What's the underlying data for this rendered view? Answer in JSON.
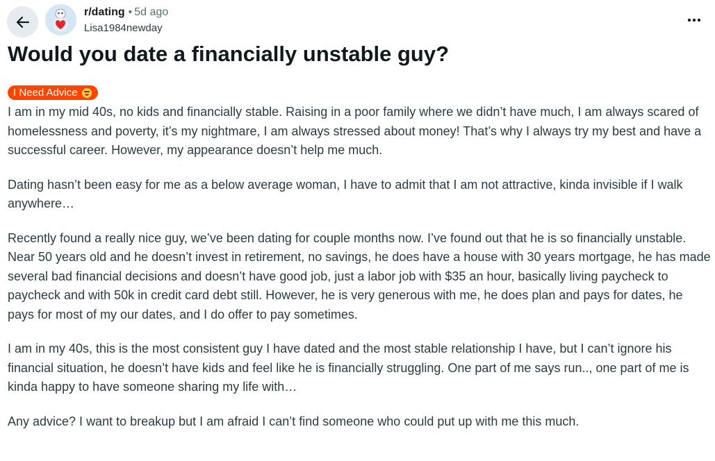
{
  "header": {
    "subreddit": "r/dating",
    "separator": "•",
    "time": "5d ago",
    "author": "Lisa1984newday",
    "back_icon": "arrow-left-icon",
    "more_icon": "more-horizontal-icon"
  },
  "post": {
    "title": "Would you date a financially unstable guy?",
    "flair": {
      "label": "I Need Advice",
      "emoji": "tired-face-emoji",
      "color": "#ff4500"
    },
    "paragraphs": [
      "I am in my mid 40s, no kids and financially stable. Raising in a poor family where we didn’t have much, I am always scared of homelessness and poverty, it’s my nightmare, I am always stressed about money! That’s why I always try my best and have a successful career. However, my appearance doesn’t help me much.",
      "Dating hasn’t been easy for me as a below average woman, I have to admit that I am not attractive, kinda invisible if I walk anywhere…",
      "Recently found a really nice guy, we’ve been dating for couple months now. I’ve found out that he is so financially unstable. Near 50 years old and he doesn’t invest in retirement, no savings, he does have a house with 30 years mortgage, he has made several bad financial decisions and doesn’t have good job, just a labor job with $35 an hour, basically living paycheck to paycheck and with 50k in credit card debt still. However, he is very generous with me, he does plan and pays for dates, he pays for most of my our dates, and I do offer to pay sometimes.",
      "I am in my 40s, this is the most consistent guy I have dated and the most stable relationship I have, but I can’t ignore his financial situation, he doesn’t have kids and feel like he is financially struggling. One part of me says run.., one part of me is kinda happy to have someone sharing my life with…",
      "Any advice? I want to breakup but I am afraid I can’t find someone who could put up with me this much."
    ]
  }
}
